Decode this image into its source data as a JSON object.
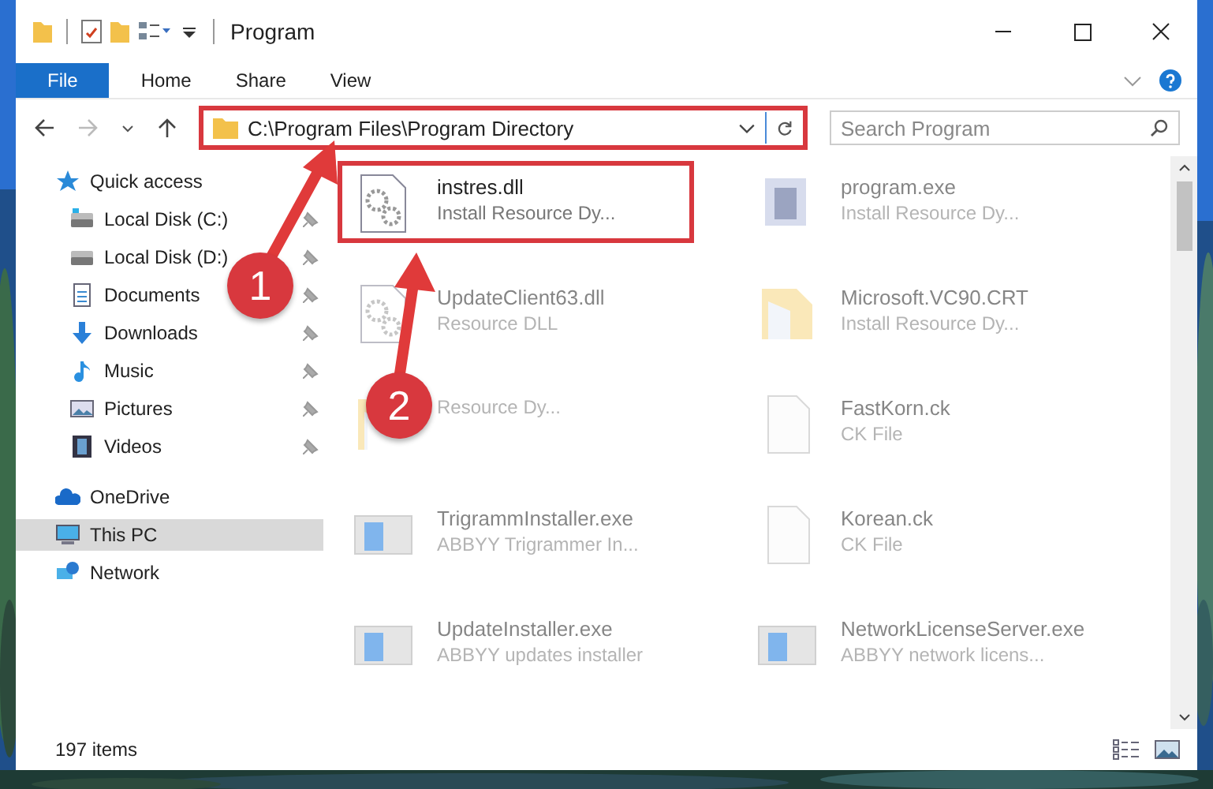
{
  "window": {
    "title": "Program"
  },
  "ribbon_tabs": [
    {
      "label": "File",
      "selected": true
    },
    {
      "label": "Home",
      "selected": false
    },
    {
      "label": "Share",
      "selected": false
    },
    {
      "label": "View",
      "selected": false
    }
  ],
  "address": {
    "path": "C:\\Program Files\\Program Directory",
    "highlighted": true
  },
  "search": {
    "placeholder": "Search Program"
  },
  "sidebar": {
    "items": [
      {
        "label": "Quick access",
        "selected": false,
        "children": [
          {
            "label": "Local Disk (C:)",
            "selected": false,
            "pinned": true
          },
          {
            "label": "Local Disk (D:)",
            "selected": false,
            "pinned": true
          },
          {
            "label": "Documents",
            "selected": false,
            "pinned": true
          },
          {
            "label": "Downloads",
            "selected": false,
            "pinned": true
          },
          {
            "label": "Music",
            "selected": false,
            "pinned": true
          },
          {
            "label": "Pictures",
            "selected": false,
            "pinned": true
          },
          {
            "label": "Videos",
            "selected": false,
            "pinned": true
          }
        ]
      },
      {
        "label": "OneDrive",
        "selected": false
      },
      {
        "label": "This PC",
        "selected": true
      },
      {
        "label": "Network",
        "selected": false
      }
    ]
  },
  "files": [
    {
      "name": "instres.dll",
      "description": "Install Resource Dy...",
      "highlighted": true
    },
    {
      "name": "program.exe",
      "description": "Install Resource Dy...",
      "highlighted": false
    },
    {
      "name": "UpdateClient63.dll",
      "description": "Resource DLL",
      "highlighted": false
    },
    {
      "name": "Microsoft.VC90.CRT",
      "description": "Install Resource Dy...",
      "highlighted": false
    },
    {
      "description": "Resource Dy...",
      "highlighted": false
    },
    {
      "name": "FastKorn.ck",
      "description": "CK File",
      "highlighted": false
    },
    {
      "name": "TrigrammInstaller.exe",
      "description": "ABBYY Trigrammer In...",
      "highlighted": false
    },
    {
      "name": "Korean.ck",
      "description": "CK File",
      "highlighted": false
    },
    {
      "name": "UpdateInstaller.exe",
      "description": "ABBYY updates installer",
      "highlighted": false
    },
    {
      "name": "NetworkLicenseServer.exe",
      "description": "ABBYY network licens...",
      "highlighted": false
    }
  ],
  "status_bar": {
    "count": "197 items"
  },
  "annotations": [
    {
      "label": "1"
    },
    {
      "label": "2"
    }
  ]
}
